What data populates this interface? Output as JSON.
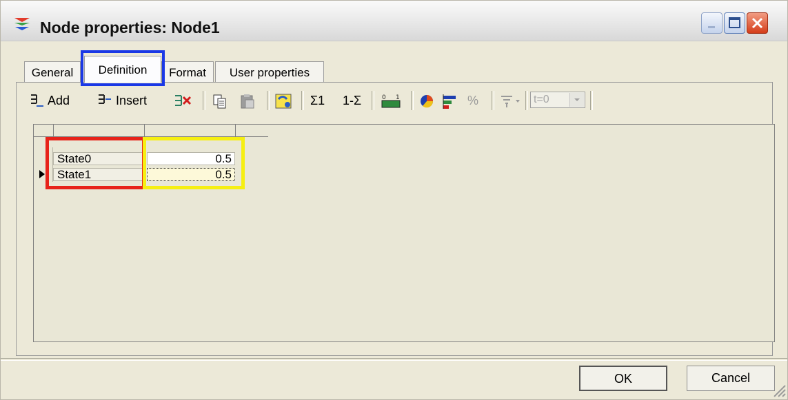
{
  "window": {
    "title": "Node properties: Node1"
  },
  "tabs": [
    {
      "label": "General",
      "active": false
    },
    {
      "label": "Definition",
      "active": true
    },
    {
      "label": "Format",
      "active": false
    },
    {
      "label": "User properties",
      "active": false
    }
  ],
  "toolbar": {
    "add_label": "Add",
    "insert_label": "Insert",
    "sum1_label": "Σ1",
    "one_sum_label": "1-Σ",
    "percent_label": "%",
    "time_select_value": "t=0"
  },
  "grid": {
    "rows": [
      {
        "name": "State0",
        "value": "0.5",
        "selected": false
      },
      {
        "name": "State1",
        "value": "0.5",
        "selected": true
      }
    ]
  },
  "buttons": {
    "ok": "OK",
    "cancel": "Cancel"
  },
  "colors": {
    "highlight_blue": "#1a38e6",
    "highlight_red": "#e7231a",
    "highlight_yellow": "#f6ef12"
  }
}
